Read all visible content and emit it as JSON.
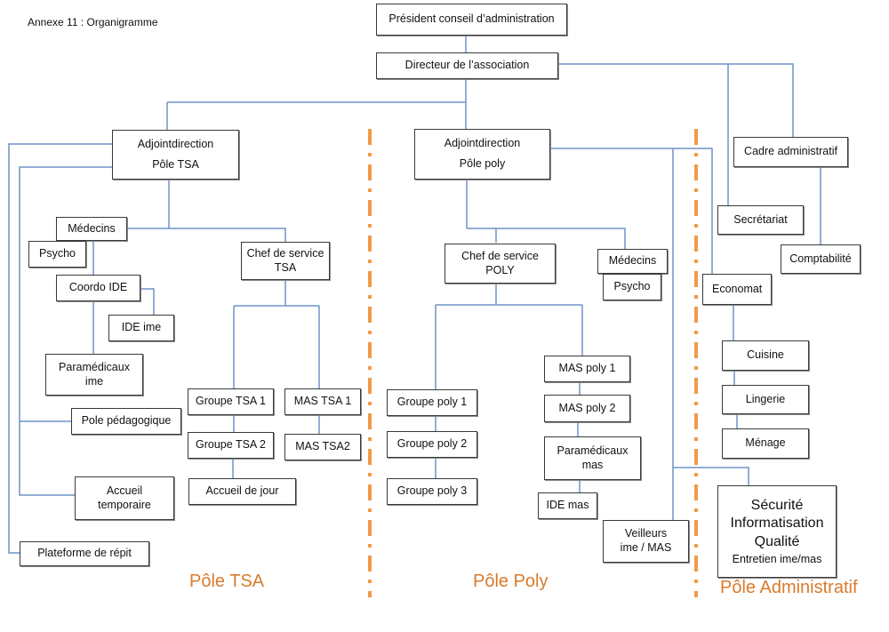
{
  "document": {
    "title": "Annexe 11 : Organigramme"
  },
  "colors": {
    "connector": "#6d94c8",
    "divider": "#f09a4a",
    "pole_label": "#d97a2b",
    "box_border": "#3a3a3a"
  },
  "nodes": {
    "president": [
      "Président conseil d’administration"
    ],
    "directeur": [
      "Directeur de l’association"
    ],
    "adjoint_tsa": [
      "Adjointdirection",
      "Pôle TSA"
    ],
    "adjoint_poly": [
      "Adjointdirection",
      "Pôle poly"
    ],
    "cadre_admin": [
      "Cadre administratif"
    ],
    "secretariat": [
      "Secrétariat"
    ],
    "comptabilite": [
      "Comptabilité"
    ],
    "medecins_tsa": [
      "Médecins"
    ],
    "psycho_tsa": [
      "Psycho"
    ],
    "coordo_ide": [
      "Coordo IDE"
    ],
    "ide_ime": [
      "IDE ime"
    ],
    "paramedicaux_ime": [
      "Paramédicaux",
      "ime"
    ],
    "chef_tsa": [
      "Chef de service",
      "TSA"
    ],
    "groupe_tsa_1": [
      "Groupe TSA 1"
    ],
    "groupe_tsa_2": [
      "Groupe TSA 2"
    ],
    "accueil_jour": [
      "Accueil de jour"
    ],
    "mas_tsa_1": [
      "MAS TSA 1"
    ],
    "mas_tsa_2": [
      "MAS TSA2"
    ],
    "pole_pedagogique": [
      "Pole pédagogique"
    ],
    "accueil_temporaire": [
      "Accueil",
      "temporaire"
    ],
    "plateforme_repit": [
      "Plateforme de répit"
    ],
    "chef_poly": [
      "Chef de service",
      "POLY"
    ],
    "medecins_poly": [
      "Médecins"
    ],
    "psycho_poly": [
      "Psycho"
    ],
    "groupe_poly_1": [
      "Groupe poly 1"
    ],
    "groupe_poly_2": [
      "Groupe poly 2"
    ],
    "groupe_poly_3": [
      "Groupe poly 3"
    ],
    "mas_poly_1": [
      "MAS poly 1"
    ],
    "mas_poly_2": [
      "MAS poly  2"
    ],
    "paramedicaux_mas": [
      "Paramédicaux",
      "mas"
    ],
    "ide_mas": [
      "IDE mas"
    ],
    "veilleurs": [
      "Veilleurs",
      "ime / MAS"
    ],
    "economat": [
      "Economat"
    ],
    "cuisine": [
      "Cuisine"
    ],
    "lingerie": [
      "Lingerie"
    ],
    "menage": [
      "Ménage"
    ],
    "securite": [
      "Sécurité",
      "Informatisation",
      "Qualité",
      "Entretien ime/mas"
    ]
  },
  "poles": {
    "tsa": "Pôle TSA",
    "poly": "Pôle Poly",
    "admin": "Pôle Administratif"
  }
}
